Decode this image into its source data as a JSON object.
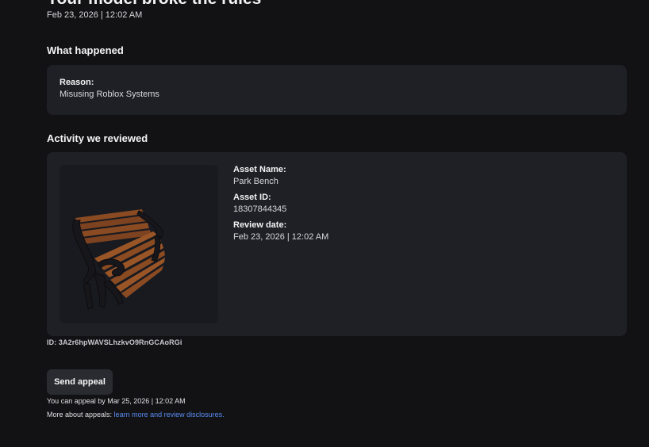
{
  "notice": {
    "title": "Your model broke the rules",
    "datetime": "Feb 23, 2026 | 12:02 AM"
  },
  "what_happened": {
    "heading": "What happened",
    "reason_label": "Reason:",
    "reason_value": "Misusing Roblox Systems"
  },
  "activity": {
    "heading": "Activity we reviewed",
    "thumbnail_icon": "park-bench-model",
    "asset_name_label": "Asset Name:",
    "asset_name_value": "Park Bench",
    "asset_id_label": "Asset ID:",
    "asset_id_value": "18307844345",
    "review_date_label": "Review date:",
    "review_date_value": "Feb 23, 2026 | 12:02 AM"
  },
  "moderation_id": "ID: 3A2r6hpWAVSLhzkvO9RnGCAoRGi",
  "appeal": {
    "button_label": "Send appeal",
    "deadline_text": "You can appeal by Mar 25, 2026 | 12:02 AM",
    "more_prefix": "More about appeals: ",
    "more_link_text": "learn more and review disclosures."
  },
  "colors": {
    "background": "#121215",
    "card": "#1f2026",
    "link": "#5a8cf2",
    "bench_wood": "#8a4a22",
    "bench_iron": "#15151a"
  }
}
